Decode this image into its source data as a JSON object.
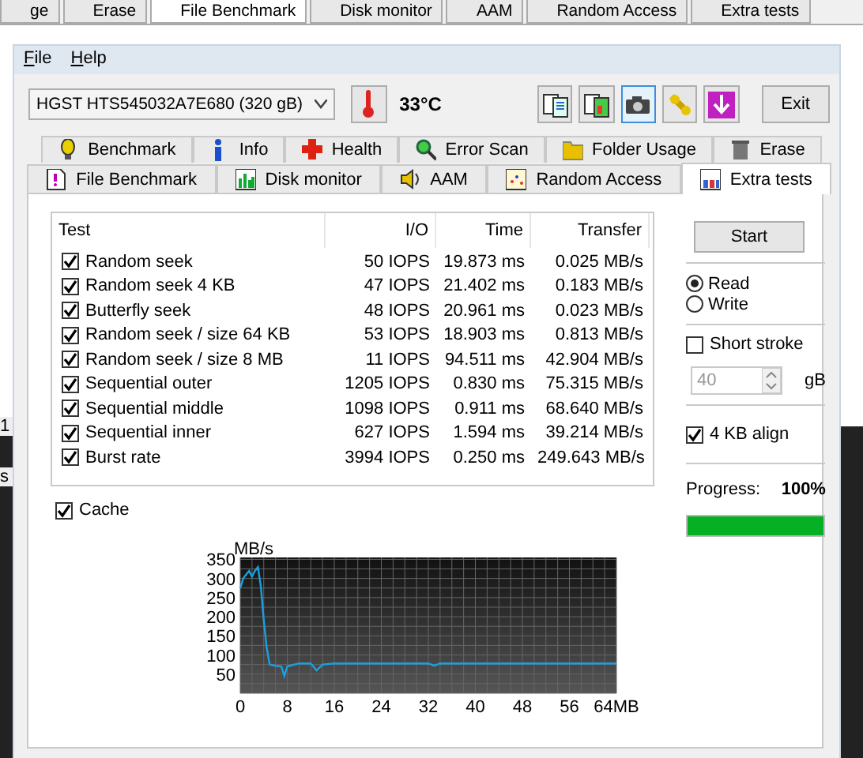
{
  "background_window": {
    "tabs": [
      {
        "label": "ge",
        "selected": false
      },
      {
        "label": "Erase",
        "selected": false
      },
      {
        "label": "File Benchmark",
        "selected": true
      },
      {
        "label": "Disk monitor",
        "selected": false
      },
      {
        "label": "AAM",
        "selected": false
      },
      {
        "label": "Random Access",
        "selected": false
      },
      {
        "label": "Extra tests",
        "selected": false
      }
    ],
    "fragments": [
      "1",
      "s"
    ]
  },
  "menu": [
    {
      "label": "File"
    },
    {
      "label": "Help"
    }
  ],
  "drive_select": {
    "value": "HGST HTS545032A7E680 (320 gB)"
  },
  "temperature": "33°C",
  "toolbar_buttons": [
    {
      "kind": "copy",
      "selected": false
    },
    {
      "kind": "copycolor",
      "selected": false
    },
    {
      "kind": "camera",
      "selected": true
    },
    {
      "kind": "tools",
      "selected": false
    },
    {
      "kind": "save",
      "selected": false
    }
  ],
  "exit_button": "Exit",
  "tab_rows": [
    [
      {
        "label": "Benchmark",
        "selected": false
      },
      {
        "label": "Info",
        "selected": false
      },
      {
        "label": "Health",
        "selected": false
      },
      {
        "label": "Error Scan",
        "selected": false
      },
      {
        "label": "Folder Usage",
        "selected": false
      },
      {
        "label": "Erase",
        "selected": false
      }
    ],
    [
      {
        "label": "File Benchmark",
        "selected": false
      },
      {
        "label": "Disk monitor",
        "selected": false
      },
      {
        "label": "AAM",
        "selected": false
      },
      {
        "label": "Random Access",
        "selected": false
      },
      {
        "label": "Extra tests",
        "selected": true
      }
    ]
  ],
  "table": {
    "columns": [
      "Test",
      "I/O",
      "Time",
      "Transfer"
    ],
    "rows": [
      {
        "checked": true,
        "cells": [
          "Random seek",
          "50 IOPS",
          "19.873 ms",
          "0.025 MB/s"
        ]
      },
      {
        "checked": true,
        "cells": [
          "Random seek 4 KB",
          "47 IOPS",
          "21.402 ms",
          "0.183 MB/s"
        ]
      },
      {
        "checked": true,
        "cells": [
          "Butterfly seek",
          "48 IOPS",
          "20.961 ms",
          "0.023 MB/s"
        ]
      },
      {
        "checked": true,
        "cells": [
          "Random seek / size 64 KB",
          "53 IOPS",
          "18.903 ms",
          "0.813 MB/s"
        ]
      },
      {
        "checked": true,
        "cells": [
          "Random seek / size 8 MB",
          "11 IOPS",
          "94.511 ms",
          "42.904 MB/s"
        ]
      },
      {
        "checked": true,
        "cells": [
          "Sequential outer",
          "1205 IOPS",
          "0.830 ms",
          "75.315 MB/s"
        ]
      },
      {
        "checked": true,
        "cells": [
          "Sequential middle",
          "1098 IOPS",
          "0.911 ms",
          "68.640 MB/s"
        ]
      },
      {
        "checked": true,
        "cells": [
          "Sequential inner",
          "627 IOPS",
          "1.594 ms",
          "39.214 MB/s"
        ]
      },
      {
        "checked": true,
        "cells": [
          "Burst rate",
          "3994 IOPS",
          "0.250 ms",
          "249.643 MB/s"
        ]
      }
    ]
  },
  "start_button": "Start",
  "mode": [
    {
      "label": "Read",
      "selected": true
    },
    {
      "label": "Write",
      "selected": false
    }
  ],
  "short_stroke": {
    "label": "Short stroke",
    "checked": false
  },
  "stroke_size": {
    "value": "40",
    "unit": "gB",
    "disabled": true
  },
  "align": {
    "label": "4 KB align",
    "checked": true
  },
  "progress": {
    "label": "Progress:",
    "value": "100%",
    "level": 1
  },
  "cache": {
    "label": "Cache",
    "checked": true
  },
  "chart": {
    "chart_data": {
      "type": "line",
      "ylabel": "MB/s",
      "x": [
        0,
        0.5,
        1,
        1.5,
        2,
        2.5,
        3,
        3.5,
        4,
        4.5,
        5,
        6,
        7,
        7.5,
        8,
        10,
        12,
        13,
        14,
        16,
        20,
        24,
        28,
        32,
        33,
        34,
        40,
        48,
        56,
        64
      ],
      "grid": true,
      "series": [
        {
          "color": "#1aa0e0",
          "values": [
            275,
            300,
            310,
            320,
            305,
            320,
            330,
            280,
            190,
            120,
            75,
            72,
            70,
            45,
            70,
            78,
            78,
            60,
            75,
            78,
            78,
            78,
            78,
            78,
            72,
            78,
            78,
            78,
            78,
            78
          ]
        }
      ],
      "xlim": [
        0,
        64
      ],
      "ylim": [
        0,
        355
      ],
      "xticks": [
        0,
        8,
        16,
        24,
        32,
        40,
        48,
        56,
        {
          "value": 64,
          "label": "64MB"
        }
      ],
      "yticks": [
        50,
        100,
        150,
        200,
        250,
        300,
        350
      ]
    }
  }
}
